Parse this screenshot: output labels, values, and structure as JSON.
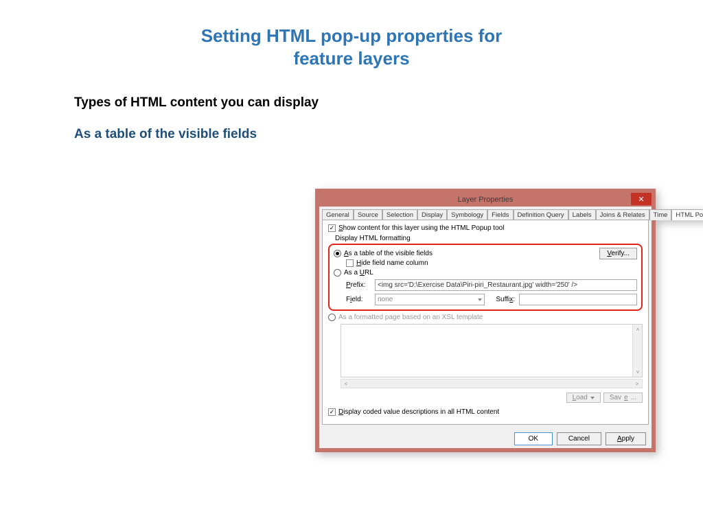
{
  "slide": {
    "title_line1": "Setting HTML pop-up properties for",
    "title_line2": "feature layers",
    "subtitle1": "Types of HTML content you can display",
    "subtitle2": "As a table of the visible fields"
  },
  "dialog": {
    "title": "Layer Properties",
    "tabs": [
      "General",
      "Source",
      "Selection",
      "Display",
      "Symbology",
      "Fields",
      "Definition Query",
      "Labels",
      "Joins & Relates",
      "Time",
      "HTML Popup"
    ],
    "active_tab": "HTML Popup",
    "show_content_label": "Show content for this layer using the HTML Popup tool",
    "display_formatting_label": "Display HTML formatting",
    "radio_table": "As a table of the visible fields",
    "hide_field_name": "Hide field name column",
    "radio_url": "As a URL",
    "prefix_label": "Prefix:",
    "prefix_value": "<img src='D:\\Exercise Data\\Piri-piri_Restaurant.jpg' width='250' />",
    "field_label": "Field:",
    "field_value": "none",
    "suffix_label": "Suffix:",
    "radio_xsl": "As a formatted page based on an XSL template",
    "verify": "Verify...",
    "display_coded": "Display coded value descriptions in all HTML content",
    "load": "Load",
    "save": "Save...",
    "ok": "OK",
    "cancel": "Cancel",
    "apply": "Apply"
  }
}
